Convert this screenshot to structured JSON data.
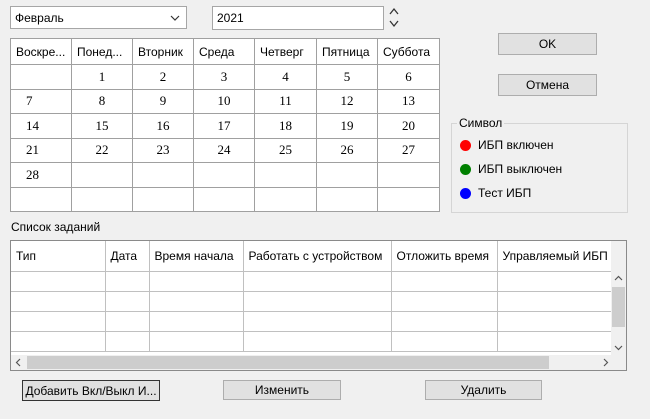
{
  "month_select": {
    "value": "Февраль"
  },
  "year_spin": {
    "value": "2021"
  },
  "calendar": {
    "days_header": [
      "Воскре...",
      "Понед...",
      "Вторник",
      "Среда",
      "Четверг",
      "Пятница",
      "Суббота"
    ],
    "weeks": [
      [
        "",
        "1",
        "2",
        "3",
        "4",
        "5",
        "6"
      ],
      [
        "7",
        "8",
        "9",
        "10",
        "11",
        "12",
        "13"
      ],
      [
        "14",
        "15",
        "16",
        "17",
        "18",
        "19",
        "20"
      ],
      [
        "21",
        "22",
        "23",
        "24",
        "25",
        "26",
        "27"
      ],
      [
        "28",
        "",
        "",
        "",
        "",
        "",
        ""
      ],
      [
        "",
        "",
        "",
        "",
        "",
        "",
        ""
      ]
    ]
  },
  "buttons": {
    "ok": "OK",
    "cancel": "Отмена",
    "add": "Добавить Вкл/Выкл И...",
    "edit": "Изменить",
    "delete": "Удалить"
  },
  "legend": {
    "title": "Символ",
    "items": [
      {
        "label": "ИБП включен",
        "color": "#ff0000"
      },
      {
        "label": "ИБП выключен",
        "color": "#008000"
      },
      {
        "label": "Тест ИБП",
        "color": "#0000ff"
      }
    ]
  },
  "tasks": {
    "label": "Список заданий",
    "columns": [
      "Тип",
      "Дата",
      "Время начала",
      "Работать с устройством",
      "Отложить время",
      "Управляемый ИБП"
    ]
  },
  "icons": {
    "dropdown": "chevron-down-icon",
    "spin_up": "arrow-up-icon",
    "spin_down": "arrow-down-icon"
  }
}
